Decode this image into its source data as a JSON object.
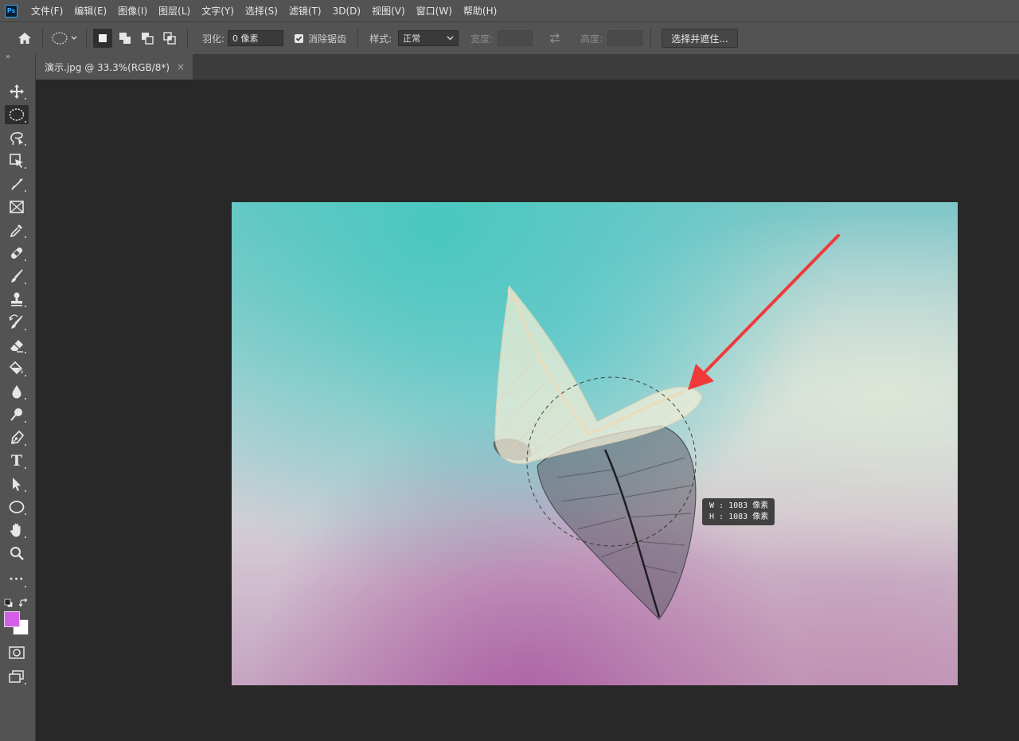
{
  "app": {
    "logo": "Ps"
  },
  "menu": [
    "文件(F)",
    "编辑(E)",
    "图像(I)",
    "图层(L)",
    "文字(Y)",
    "选择(S)",
    "滤镜(T)",
    "3D(D)",
    "视图(V)",
    "窗口(W)",
    "帮助(H)"
  ],
  "options": {
    "feather_label": "羽化:",
    "feather_value": "0 像素",
    "antialias_label": "消除锯齿",
    "style_label": "样式:",
    "style_value": "正常",
    "width_label": "宽度:",
    "height_label": "高度:",
    "select_mask_button": "选择并遮住..."
  },
  "document": {
    "tab_title": "演示.jpg @ 33.3%(RGB/8*)",
    "close": "×"
  },
  "tooltip": {
    "w_text": "W : 1083 像素",
    "h_text": "H : 1083 像素"
  },
  "toolbar": {
    "collapse": "»",
    "tools": [
      "move",
      "elliptical-marquee",
      "lasso",
      "object-select",
      "crop",
      "frame",
      "eyedropper",
      "healing-brush",
      "brush",
      "clone-stamp",
      "history-brush",
      "eraser",
      "paint-bucket",
      "blur",
      "dodge",
      "pen",
      "type",
      "path-selection",
      "ellipse",
      "hand",
      "zoom",
      "edit-toolbar"
    ],
    "type_glyph": "T",
    "more_glyph": "···"
  },
  "colors": {
    "foreground": "#d45ee8",
    "background": "#ffffff",
    "annotation_arrow": "#f03a3a",
    "ui_panel": "#535353",
    "canvas_bg": "#282828"
  }
}
